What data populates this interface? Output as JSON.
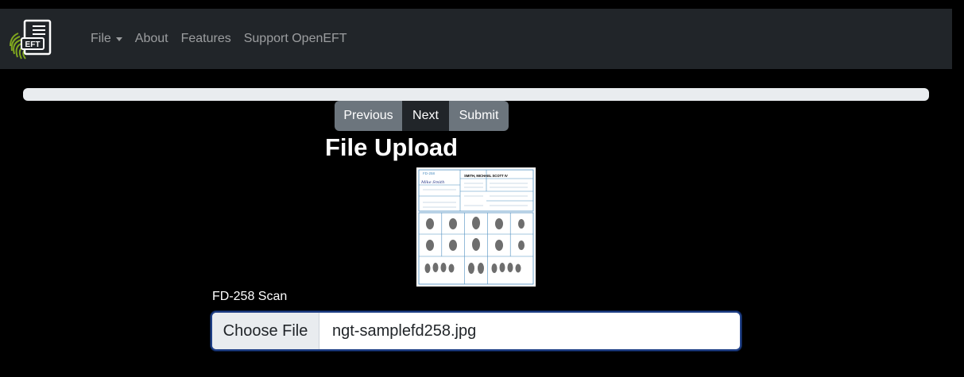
{
  "navbar": {
    "logo_text": "EFT",
    "items": [
      {
        "label": "File",
        "has_dropdown": true
      },
      {
        "label": "About"
      },
      {
        "label": "Features"
      },
      {
        "label": "Support OpenEFT"
      }
    ]
  },
  "progress": {
    "value": 0
  },
  "buttons": {
    "previous": "Previous",
    "next": "Next",
    "submit": "Submit"
  },
  "page": {
    "title": "File Upload"
  },
  "scan_preview": {
    "name_field": "SMITH, MICHAEL SCOTT IV",
    "form_label": "FD-258",
    "signature": "Mike Smith"
  },
  "upload": {
    "label": "FD-258 Scan",
    "button": "Choose File",
    "filename": "ngt-samplefd258.jpg"
  },
  "colors": {
    "navbar_bg": "#212529",
    "secondary": "#6c757d",
    "dark": "#212529",
    "progress_track": "#e9ecef",
    "logo_green": "#7fa61e"
  }
}
